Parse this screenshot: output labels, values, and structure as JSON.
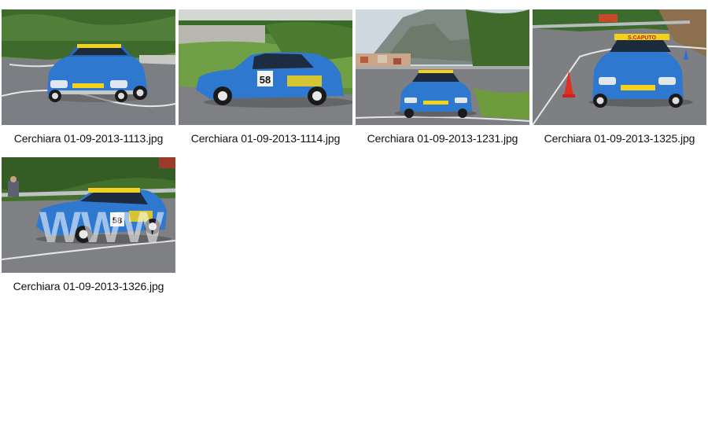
{
  "gallery": {
    "items": [
      {
        "filename": "Cerchiara 01-09-2013-1113.jpg"
      },
      {
        "filename": "Cerchiara 01-09-2013-1114.jpg",
        "race_number": "58"
      },
      {
        "filename": "Cerchiara 01-09-2013-1231.jpg"
      },
      {
        "filename": "Cerchiara 01-09-2013-1325.jpg",
        "banner_text": "S.CAPUTO"
      },
      {
        "filename": "Cerchiara 01-09-2013-1326.jpg",
        "race_number": "58",
        "watermark": "WWW"
      }
    ]
  },
  "colors": {
    "car_blue": "#2f78d0",
    "car_yellow": "#f2d21a",
    "asphalt": "#7d7f82",
    "foliage": "#3f6a2a",
    "sky": "#cfd8df"
  }
}
